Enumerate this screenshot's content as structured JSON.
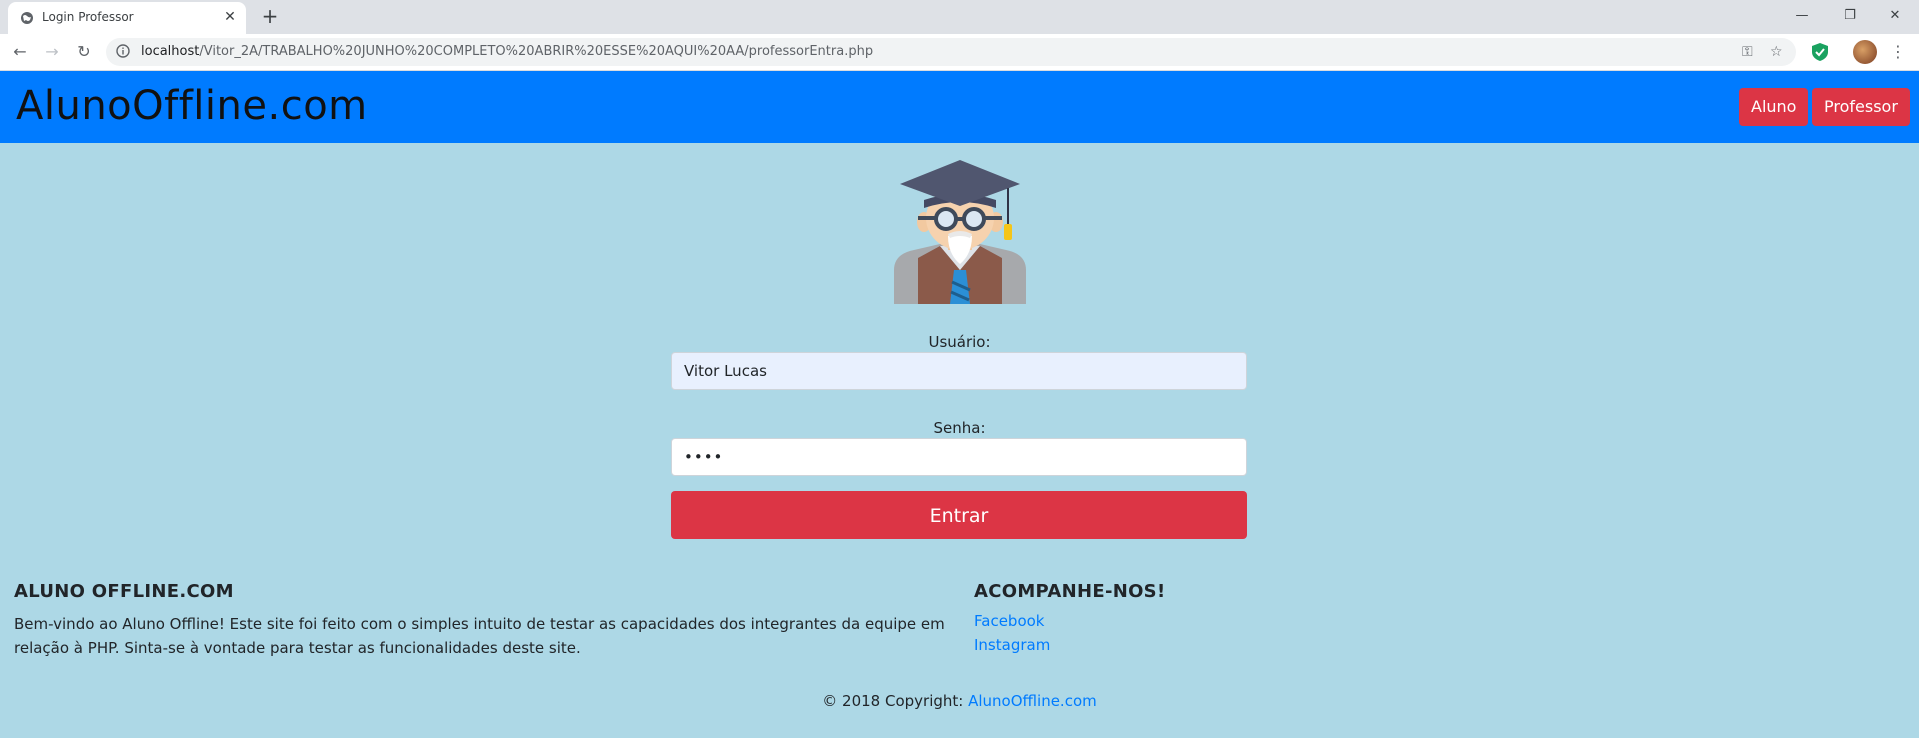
{
  "browser": {
    "tab_title": "Login Professor",
    "tab_close": "✕",
    "new_tab": "+",
    "url_host": "localhost",
    "url_path": "/Vitor_2A/TRABALHO%20JUNHO%20COMPLETO%20ABRIR%20ESSE%20AQUI%20AA/professorEntra.php",
    "window_controls": {
      "minimize": "—",
      "restore": "❐",
      "close": "✕"
    },
    "nav": {
      "back": "←",
      "forward": "→",
      "reload": "↻"
    },
    "omnibox_icons": {
      "key": "⚿",
      "star": "☆"
    },
    "menu": "⋮"
  },
  "navbar": {
    "brand": "AlunoOffline.com",
    "aluno_button": "Aluno",
    "professor_button": "Professor"
  },
  "login": {
    "user_label": "Usuário:",
    "user_value": "Vitor Lucas",
    "password_label": "Senha:",
    "password_value": "••••",
    "submit_label": "Entrar"
  },
  "footer": {
    "about_title": "ALUNO OFFLINE.COM",
    "about_text": "Bem-vindo ao Aluno Offline! Este site foi feito com o simples intuito de testar as capacidades dos integrantes da equipe em relação à PHP. Sinta-se à vontade para testar as funcionalidades deste site.",
    "follow_title": "ACOMPANHE-NOS!",
    "links": [
      "Facebook",
      "Instagram"
    ],
    "copyright_prefix": "© 2018 Copyright: ",
    "copyright_link": "AlunoOffline.com"
  },
  "colors": {
    "page_bg": "#add8e6",
    "navbar_bg": "#007bff",
    "button_red": "#dc3545",
    "link_blue": "#007bff"
  }
}
